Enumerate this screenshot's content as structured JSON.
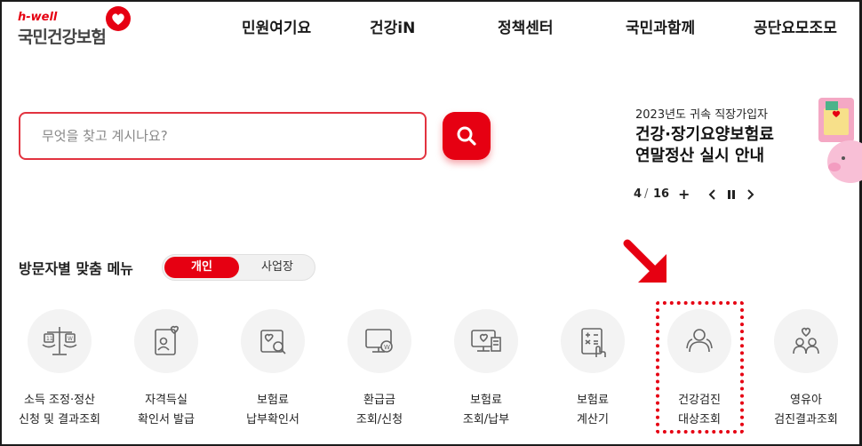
{
  "brand": {
    "tagline": "h-well",
    "name": "국민건강보험"
  },
  "nav": [
    "민원여기요",
    "건강iN",
    "정책센터",
    "국민과함께",
    "공단요모조모"
  ],
  "search": {
    "placeholder": "무엇을 찾고 계시나요?"
  },
  "banner": {
    "subtitle": "2023년도 귀속 직장가입자",
    "title_line1": "건강·장기요양보험료",
    "title_line2": "연말정산 실시 안내",
    "current": "4",
    "separator": "/",
    "total": "16",
    "add": "+"
  },
  "visitor_menu": {
    "title": "방문자별 맞춤 메뉴",
    "tabs": [
      "개인",
      "사업장"
    ],
    "active_tab": "개인"
  },
  "quick_menu": [
    {
      "line1": "소득 조정·정산",
      "line2": "신청 및 결과조회",
      "icon": "scale-icon"
    },
    {
      "line1": "자격득실",
      "line2": "확인서 발급",
      "icon": "id-card-heart-icon"
    },
    {
      "line1": "보험료",
      "line2": "납부확인서",
      "icon": "document-search-icon"
    },
    {
      "line1": "환급금",
      "line2": "조회/신청",
      "icon": "refund-monitor-icon"
    },
    {
      "line1": "보험료",
      "line2": "조회/납부",
      "icon": "computer-bill-icon"
    },
    {
      "line1": "보험료",
      "line2": "계산기",
      "icon": "calculator-icon"
    },
    {
      "line1": "건강검진",
      "line2": "대상조회",
      "icon": "people-icon"
    },
    {
      "line1": "영유아",
      "line2": "검진결과조회",
      "icon": "family-heart-icon"
    }
  ],
  "colors": {
    "accent": "#e60012",
    "text": "#222222",
    "icon_bg": "#f3f3f3"
  }
}
